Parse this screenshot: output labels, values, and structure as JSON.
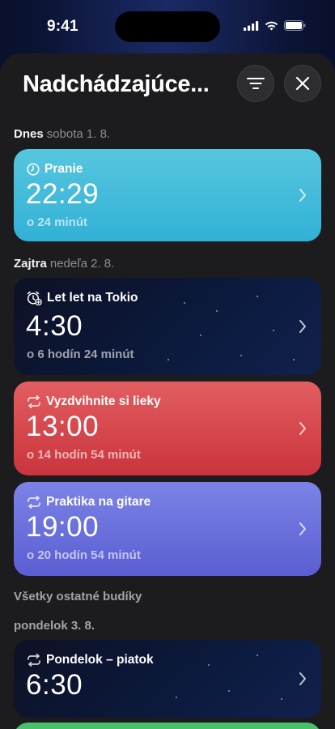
{
  "status": {
    "time": "9:41"
  },
  "header": {
    "title": "Nadchádzajúce..."
  },
  "today": {
    "label": "Dnes",
    "date": "sobota 1. 8."
  },
  "tomorrow": {
    "label": "Zajtra",
    "date": "nedeľa 2. 8."
  },
  "others": {
    "label": "Všetky ostatné budíky"
  },
  "monday": {
    "label": "pondelok 3. 8."
  },
  "alarms": [
    {
      "name": "Pranie",
      "time": "22:29",
      "remaining": "o 24 minút",
      "icon": "clock-icon",
      "color": "#3bb8da"
    },
    {
      "name": "Let let na Tokio",
      "time": "4:30",
      "remaining": "o 6 hodín 24 minút",
      "icon": "alarm-plus-icon",
      "color": "#0d1530"
    },
    {
      "name": "Vyzdvihnite si lieky",
      "time": "13:00",
      "remaining": "o 14 hodín 54 minút",
      "icon": "repeat-icon",
      "color": "#d8464c"
    },
    {
      "name": "Praktika na gitare",
      "time": "19:00",
      "remaining": "o 20 hodín 54 minút",
      "icon": "repeat-icon",
      "color": "#6a70dd"
    },
    {
      "name": "Pondelok – piatok",
      "time": "6:30",
      "remaining": "",
      "icon": "repeat-icon",
      "color": "#0d1530"
    }
  ]
}
